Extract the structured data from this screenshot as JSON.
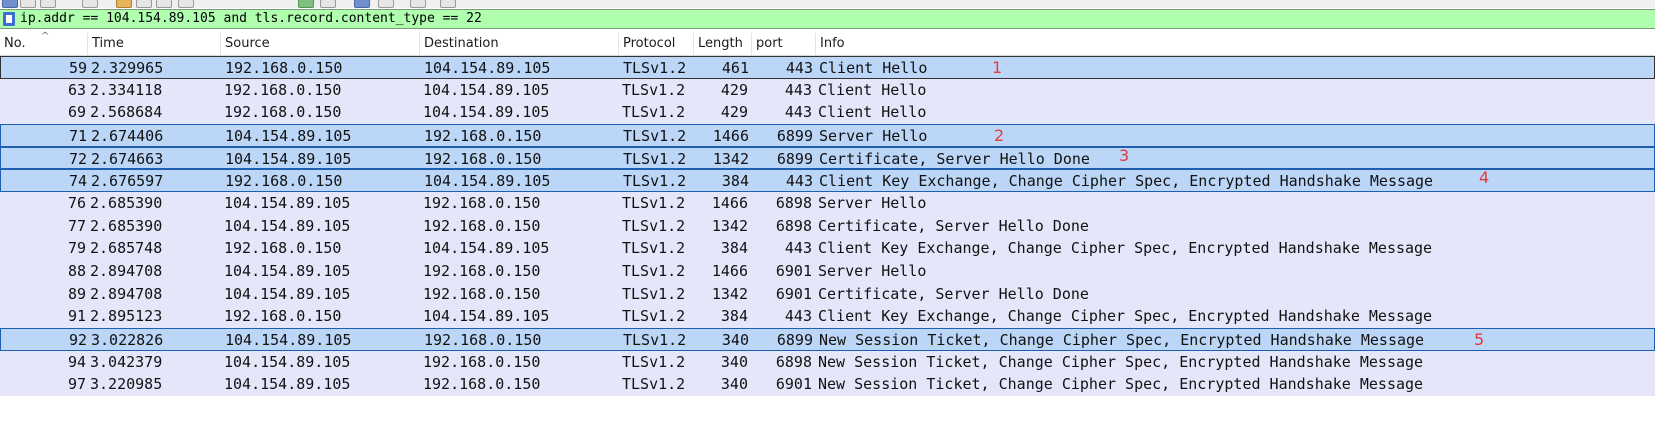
{
  "toolbar": {
    "icons": [
      "toolbar-icon-1",
      "toolbar-icon-2",
      "toolbar-icon-3",
      "toolbar-icon-4",
      "toolbar-icon-5",
      "toolbar-icon-6",
      "toolbar-icon-7",
      "toolbar-icon-8",
      "toolbar-icon-9",
      "toolbar-icon-10",
      "toolbar-icon-11",
      "toolbar-icon-12",
      "toolbar-icon-13",
      "toolbar-icon-14"
    ]
  },
  "filter": {
    "value": "ip.addr == 104.154.89.105 and tls.record.content_type == 22",
    "background": "#afffaf"
  },
  "columns": {
    "no": "No.",
    "time": "Time",
    "source": "Source",
    "destination": "Destination",
    "protocol": "Protocol",
    "length": "Length",
    "port": "port",
    "info": "Info"
  },
  "colors": {
    "row_bg": "#e6e6fa",
    "selected_bg": "#bcd6f8",
    "annotation": "#e23b3b"
  },
  "rows": [
    {
      "no": "59",
      "time": "2.329965",
      "src": "192.168.0.150",
      "dst": "104.154.89.105",
      "proto": "TLSv1.2",
      "len": "461",
      "port": "443",
      "info": "Client Hello",
      "annot": "1",
      "sel": "sel0"
    },
    {
      "no": "63",
      "time": "2.334118",
      "src": "192.168.0.150",
      "dst": "104.154.89.105",
      "proto": "TLSv1.2",
      "len": "429",
      "port": "443",
      "info": "Client Hello",
      "annot": "",
      "sel": ""
    },
    {
      "no": "69",
      "time": "2.568684",
      "src": "192.168.0.150",
      "dst": "104.154.89.105",
      "proto": "TLSv1.2",
      "len": "429",
      "port": "443",
      "info": "Client Hello",
      "annot": "",
      "sel": ""
    },
    {
      "no": "71",
      "time": "2.674406",
      "src": "104.154.89.105",
      "dst": "192.168.0.150",
      "proto": "TLSv1.2",
      "len": "1466",
      "port": "6899",
      "info": "Server Hello",
      "annot": "2",
      "sel": "sel"
    },
    {
      "no": "72",
      "time": "2.674663",
      "src": "104.154.89.105",
      "dst": "192.168.0.150",
      "proto": "TLSv1.2",
      "len": "1342",
      "port": "6899",
      "info": "Certificate, Server Hello Done",
      "annot": "3",
      "sel": "sel"
    },
    {
      "no": "74",
      "time": "2.676597",
      "src": "192.168.0.150",
      "dst": "104.154.89.105",
      "proto": "TLSv1.2",
      "len": "384",
      "port": "443",
      "info": "Client Key Exchange, Change Cipher Spec, Encrypted Handshake Message",
      "annot": "4",
      "sel": "sel"
    },
    {
      "no": "76",
      "time": "2.685390",
      "src": "104.154.89.105",
      "dst": "192.168.0.150",
      "proto": "TLSv1.2",
      "len": "1466",
      "port": "6898",
      "info": "Server Hello",
      "annot": "",
      "sel": ""
    },
    {
      "no": "77",
      "time": "2.685390",
      "src": "104.154.89.105",
      "dst": "192.168.0.150",
      "proto": "TLSv1.2",
      "len": "1342",
      "port": "6898",
      "info": "Certificate, Server Hello Done",
      "annot": "",
      "sel": ""
    },
    {
      "no": "79",
      "time": "2.685748",
      "src": "192.168.0.150",
      "dst": "104.154.89.105",
      "proto": "TLSv1.2",
      "len": "384",
      "port": "443",
      "info": "Client Key Exchange, Change Cipher Spec, Encrypted Handshake Message",
      "annot": "",
      "sel": ""
    },
    {
      "no": "88",
      "time": "2.894708",
      "src": "104.154.89.105",
      "dst": "192.168.0.150",
      "proto": "TLSv1.2",
      "len": "1466",
      "port": "6901",
      "info": "Server Hello",
      "annot": "",
      "sel": ""
    },
    {
      "no": "89",
      "time": "2.894708",
      "src": "104.154.89.105",
      "dst": "192.168.0.150",
      "proto": "TLSv1.2",
      "len": "1342",
      "port": "6901",
      "info": "Certificate, Server Hello Done",
      "annot": "",
      "sel": ""
    },
    {
      "no": "91",
      "time": "2.895123",
      "src": "192.168.0.150",
      "dst": "104.154.89.105",
      "proto": "TLSv1.2",
      "len": "384",
      "port": "443",
      "info": "Client Key Exchange, Change Cipher Spec, Encrypted Handshake Message",
      "annot": "",
      "sel": ""
    },
    {
      "no": "92",
      "time": "3.022826",
      "src": "104.154.89.105",
      "dst": "192.168.0.150",
      "proto": "TLSv1.2",
      "len": "340",
      "port": "6899",
      "info": "New Session Ticket, Change Cipher Spec, Encrypted Handshake Message",
      "annot": "5",
      "sel": "sel"
    },
    {
      "no": "94",
      "time": "3.042379",
      "src": "104.154.89.105",
      "dst": "192.168.0.150",
      "proto": "TLSv1.2",
      "len": "340",
      "port": "6898",
      "info": "New Session Ticket, Change Cipher Spec, Encrypted Handshake Message",
      "annot": "",
      "sel": ""
    },
    {
      "no": "97",
      "time": "3.220985",
      "src": "104.154.89.105",
      "dst": "192.168.0.150",
      "proto": "TLSv1.2",
      "len": "340",
      "port": "6901",
      "info": "New Session Ticket, Change Cipher Spec, Encrypted Handshake Message",
      "annot": "",
      "sel": ""
    }
  ]
}
